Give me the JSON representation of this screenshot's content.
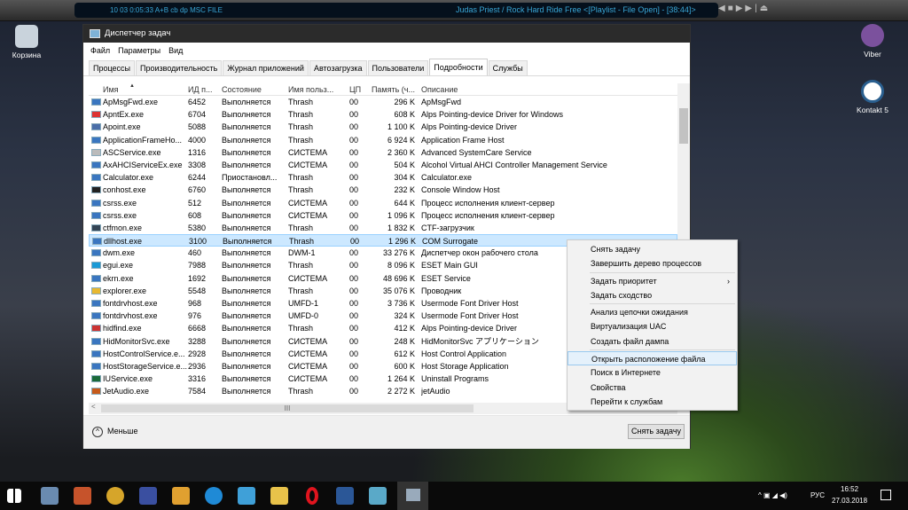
{
  "player": {
    "counters": "10    03    0:05:33   A+B  cb  dp  MSC  FILE",
    "track": "Judas Priest / Rock Hard Ride Free    <[Playlist - File Open] - [38:44]>"
  },
  "desktop": {
    "recycle": "Корзина",
    "viber": "Viber",
    "kontakt": "Kontakt 5"
  },
  "window": {
    "title": "Диспетчер задач",
    "menu": [
      "Файл",
      "Параметры",
      "Вид"
    ],
    "tabs": [
      "Процессы",
      "Производительность",
      "Журнал приложений",
      "Автозагрузка",
      "Пользователи",
      "Подробности",
      "Службы"
    ],
    "active_tab": "Подробности",
    "columns": [
      "Имя",
      "ИД п...",
      "Состояние",
      "Имя польз...",
      "ЦП",
      "Память (ч...",
      "Описание"
    ],
    "rows": [
      [
        "ApMsgFwd.exe",
        "6452",
        "Выполняется",
        "Thrash",
        "00",
        "296 K",
        "ApMsgFwd"
      ],
      [
        "ApntEx.exe",
        "6704",
        "Выполняется",
        "Thrash",
        "00",
        "608 K",
        "Alps Pointing-device Driver for Windows"
      ],
      [
        "Apoint.exe",
        "5088",
        "Выполняется",
        "Thrash",
        "00",
        "1 100 K",
        "Alps Pointing-device Driver"
      ],
      [
        "ApplicationFrameHo...",
        "4000",
        "Выполняется",
        "Thrash",
        "00",
        "6 924 K",
        "Application Frame Host"
      ],
      [
        "ASCService.exe",
        "1316",
        "Выполняется",
        "СИСТЕМА",
        "00",
        "2 360 K",
        "Advanced SystemCare Service"
      ],
      [
        "AxAHCIServiceEx.exe",
        "3308",
        "Выполняется",
        "СИСТЕМА",
        "00",
        "504 K",
        "Alcohol Virtual AHCI Controller Management Service"
      ],
      [
        "Calculator.exe",
        "6244",
        "Приостановл...",
        "Thrash",
        "00",
        "304 K",
        "Calculator.exe"
      ],
      [
        "conhost.exe",
        "6760",
        "Выполняется",
        "Thrash",
        "00",
        "232 K",
        "Console Window Host"
      ],
      [
        "csrss.exe",
        "512",
        "Выполняется",
        "СИСТЕМА",
        "00",
        "644 K",
        "Процесс исполнения клиент-сервер"
      ],
      [
        "csrss.exe",
        "608",
        "Выполняется",
        "СИСТЕМА",
        "00",
        "1 096 K",
        "Процесс исполнения клиент-сервер"
      ],
      [
        "ctfmon.exe",
        "5380",
        "Выполняется",
        "Thrash",
        "00",
        "1 832 K",
        "CTF-загрузчик"
      ],
      [
        "dllhost.exe",
        "3100",
        "Выполняется",
        "Thrash",
        "00",
        "1 296 K",
        "COM Surrogate"
      ],
      [
        "dwm.exe",
        "460",
        "Выполняется",
        "DWM-1",
        "00",
        "33 276 K",
        "Диспетчер окон рабочего стола"
      ],
      [
        "egui.exe",
        "7988",
        "Выполняется",
        "Thrash",
        "00",
        "8 096 K",
        "ESET Main GUI"
      ],
      [
        "ekrn.exe",
        "1692",
        "Выполняется",
        "СИСТЕМА",
        "00",
        "48 696 K",
        "ESET Service"
      ],
      [
        "explorer.exe",
        "5548",
        "Выполняется",
        "Thrash",
        "00",
        "35 076 K",
        "Проводник"
      ],
      [
        "fontdrvhost.exe",
        "968",
        "Выполняется",
        "UMFD-1",
        "00",
        "3 736 K",
        "Usermode Font Driver Host"
      ],
      [
        "fontdrvhost.exe",
        "976",
        "Выполняется",
        "UMFD-0",
        "00",
        "324 K",
        "Usermode Font Driver Host"
      ],
      [
        "hidfind.exe",
        "6668",
        "Выполняется",
        "Thrash",
        "00",
        "412 K",
        "Alps Pointing-device Driver"
      ],
      [
        "HidMonitorSvc.exe",
        "3288",
        "Выполняется",
        "СИСТЕМА",
        "00",
        "248 K",
        "HidMonitorSvc アプリケーション"
      ],
      [
        "HostControlService.e...",
        "2928",
        "Выполняется",
        "СИСТЕМА",
        "00",
        "612 K",
        "Host Control Application"
      ],
      [
        "HostStorageService.e...",
        "2936",
        "Выполняется",
        "СИСТЕМА",
        "00",
        "600 K",
        "Host Storage Application"
      ],
      [
        "IUService.exe",
        "3316",
        "Выполняется",
        "СИСТЕМА",
        "00",
        "1 264 K",
        "Uninstall Programs"
      ],
      [
        "JetAudio.exe",
        "7584",
        "Выполняется",
        "Thrash",
        "00",
        "2 272 K",
        "jetAudio"
      ]
    ],
    "selected_row": "dllhost.exe",
    "less": "Меньше",
    "end_task": "Снять задачу"
  },
  "context_menu": {
    "groups": [
      [
        "Снять задачу",
        "Завершить дерево процессов"
      ],
      [
        "Задать приоритет",
        "Задать сходство"
      ],
      [
        "Анализ цепочки ожидания",
        "Виртуализация UAC",
        "Создать файл дампа"
      ],
      [
        "Открыть расположение файла",
        "Поиск в Интернете",
        "Свойства",
        "Перейти к службам"
      ]
    ],
    "highlighted": "Открыть расположение файла",
    "submenu": "Задать приоритет"
  },
  "taskbar": {
    "lang": "РУС",
    "time": "16:52",
    "date": "27.03.2018"
  }
}
